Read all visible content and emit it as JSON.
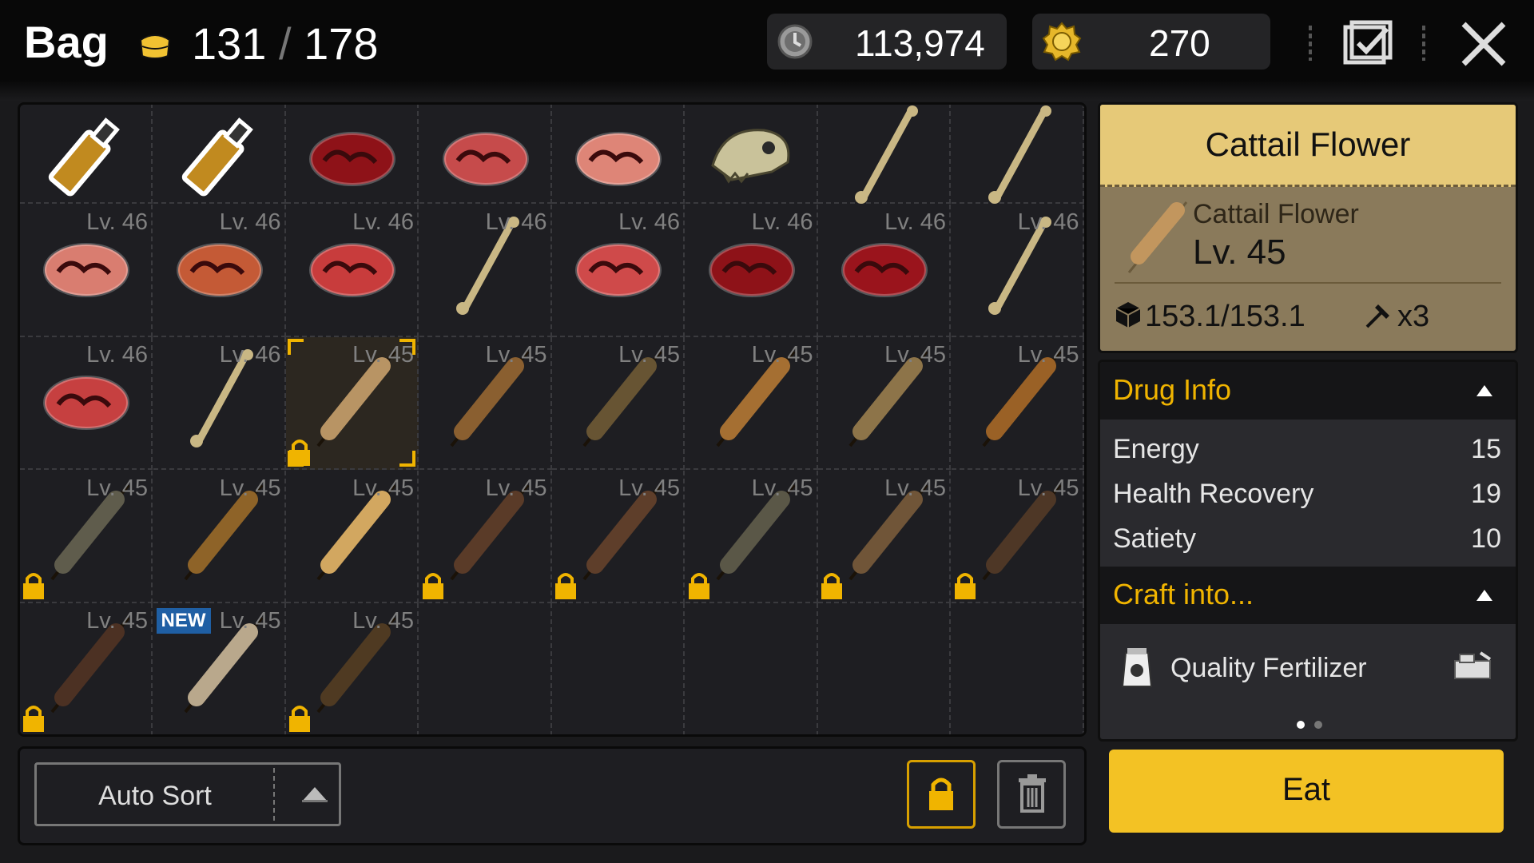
{
  "header": {
    "title": "Bag",
    "capacity_used": "131",
    "capacity_sep": "/",
    "capacity_max": "178",
    "silver": "113,974",
    "gold": "270"
  },
  "grid": [
    {
      "icon": "bottle-icon",
      "lv": "",
      "locked": false,
      "new": false,
      "color": "#c18a1f"
    },
    {
      "icon": "bottle-icon",
      "lv": "",
      "locked": false,
      "new": false,
      "color": "#c18a1f"
    },
    {
      "icon": "meat-icon",
      "lv": "",
      "locked": false,
      "new": false,
      "color": "#8e1218"
    },
    {
      "icon": "meat-icon",
      "lv": "",
      "locked": false,
      "new": false,
      "color": "#c64b4b"
    },
    {
      "icon": "meat-icon",
      "lv": "",
      "locked": false,
      "new": false,
      "color": "#de8577"
    },
    {
      "icon": "dino-skull-icon",
      "lv": "",
      "locked": false,
      "new": false,
      "color": "#c9c29a"
    },
    {
      "icon": "bone-icon",
      "lv": "",
      "locked": false,
      "new": false,
      "color": "#c9b784"
    },
    {
      "icon": "bone-icon",
      "lv": "",
      "locked": false,
      "new": false,
      "color": "#c9b784"
    },
    {
      "icon": "meat-icon",
      "lv": "Lv. 46",
      "locked": false,
      "new": false,
      "color": "#d97d70"
    },
    {
      "icon": "meat-icon",
      "lv": "Lv. 46",
      "locked": false,
      "new": false,
      "color": "#c45a36"
    },
    {
      "icon": "meat-icon",
      "lv": "Lv. 46",
      "locked": false,
      "new": false,
      "color": "#c83c3c"
    },
    {
      "icon": "bone-icon",
      "lv": "Lv. 46",
      "locked": false,
      "new": false,
      "color": "#c9b784"
    },
    {
      "icon": "meat-icon",
      "lv": "Lv. 46",
      "locked": false,
      "new": false,
      "color": "#cf4a4a"
    },
    {
      "icon": "meat-icon",
      "lv": "Lv. 46",
      "locked": false,
      "new": false,
      "color": "#8e1218"
    },
    {
      "icon": "meat-icon",
      "lv": "Lv. 46",
      "locked": false,
      "new": false,
      "color": "#9a141c"
    },
    {
      "icon": "bone-icon",
      "lv": "Lv. 46",
      "locked": false,
      "new": false,
      "color": "#c9b784"
    },
    {
      "icon": "meat-icon",
      "lv": "Lv. 46",
      "locked": false,
      "new": false,
      "color": "#c64040"
    },
    {
      "icon": "bone-icon",
      "lv": "Lv. 46",
      "locked": false,
      "new": false,
      "color": "#c9b784"
    },
    {
      "icon": "cattail-icon",
      "lv": "Lv. 45",
      "locked": true,
      "new": false,
      "color": "#b89464",
      "selected": true
    },
    {
      "icon": "cattail-icon",
      "lv": "Lv. 45",
      "locked": false,
      "new": false,
      "color": "#8a5f30"
    },
    {
      "icon": "cattail-icon",
      "lv": "Lv. 45",
      "locked": false,
      "new": false,
      "color": "#675433"
    },
    {
      "icon": "cattail-icon",
      "lv": "Lv. 45",
      "locked": false,
      "new": false,
      "color": "#a56f32"
    },
    {
      "icon": "cattail-icon",
      "lv": "Lv. 45",
      "locked": false,
      "new": false,
      "color": "#8d7449"
    },
    {
      "icon": "cattail-icon",
      "lv": "Lv. 45",
      "locked": false,
      "new": false,
      "color": "#9a6126"
    },
    {
      "icon": "cattail-icon",
      "lv": "Lv. 45",
      "locked": true,
      "new": false,
      "color": "#5f5c4c"
    },
    {
      "icon": "cattail-icon",
      "lv": "Lv. 45",
      "locked": false,
      "new": false,
      "color": "#8e6328"
    },
    {
      "icon": "cattail-icon",
      "lv": "Lv. 45",
      "locked": false,
      "new": false,
      "color": "#d2a760"
    },
    {
      "icon": "cattail-icon",
      "lv": "Lv. 45",
      "locked": true,
      "new": false,
      "color": "#5a3b28"
    },
    {
      "icon": "cattail-icon",
      "lv": "Lv. 45",
      "locked": true,
      "new": false,
      "color": "#5e3e2a"
    },
    {
      "icon": "cattail-icon",
      "lv": "Lv. 45",
      "locked": true,
      "new": false,
      "color": "#5a5747"
    },
    {
      "icon": "cattail-icon",
      "lv": "Lv. 45",
      "locked": true,
      "new": false,
      "color": "#705538"
    },
    {
      "icon": "cattail-icon",
      "lv": "Lv. 45",
      "locked": true,
      "new": false,
      "color": "#4e3726"
    },
    {
      "icon": "cattail-icon",
      "lv": "Lv. 45",
      "locked": true,
      "new": false,
      "color": "#4c3123"
    },
    {
      "icon": "cattail-icon",
      "lv": "Lv. 45",
      "locked": false,
      "new": true,
      "new_label": "NEW",
      "color": "#b9a88c"
    },
    {
      "icon": "cattail-icon",
      "lv": "Lv. 45",
      "locked": true,
      "new": false,
      "color": "#4f3a22"
    },
    null,
    null,
    null,
    null,
    null
  ],
  "bottom": {
    "auto_sort": "Auto Sort"
  },
  "detail": {
    "header_title": "Cattail Flower",
    "name": "Cattail Flower",
    "level": "Lv. 45",
    "weight": "153.1/153.1",
    "durability": "x3"
  },
  "drug_info": {
    "title": "Drug Info",
    "stats": [
      {
        "label": "Energy",
        "value": "15"
      },
      {
        "label": "Health Recovery",
        "value": "19"
      },
      {
        "label": "Satiety",
        "value": "10"
      }
    ]
  },
  "craft": {
    "title": "Craft into...",
    "items": [
      {
        "label": "Quality Fertilizer",
        "icon": "fertilizer-bag-icon",
        "tool": "workbench-icon"
      }
    ],
    "page": 1,
    "pages": 2
  },
  "action": {
    "eat_label": "Eat"
  },
  "colors": {
    "accent": "#f0b400",
    "eat_button": "#f3c224",
    "detail_header": "#e6c978",
    "new_badge": "#1f5fa4"
  }
}
